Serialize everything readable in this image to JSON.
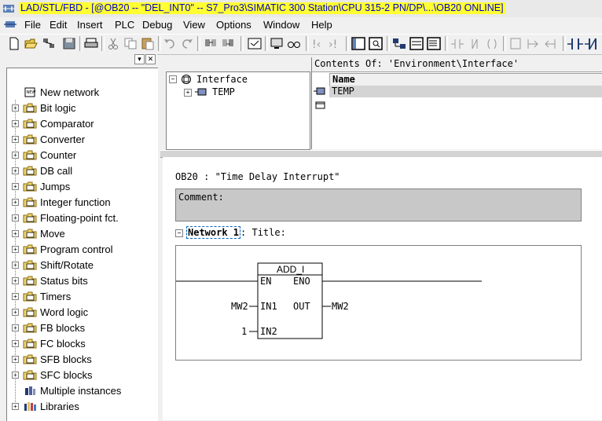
{
  "window": {
    "title": "LAD/STL/FBD  - [@OB20 -- \"DEL_INT0\" -- S7_Pro3\\SIMATIC 300 Station\\CPU 315-2 PN/DP\\...\\OB20  ONLINE]"
  },
  "menu": [
    "File",
    "Edit",
    "Insert",
    "PLC",
    "Debug",
    "View",
    "Options",
    "Window",
    "Help"
  ],
  "toolbar": {
    "icons": [
      "new-icon",
      "open-icon",
      "accessible-nodes-icon",
      "save-icon",
      "print-icon",
      "cut-icon",
      "copy-icon",
      "paste-icon",
      "undo-icon",
      "redo-icon",
      "download-icon",
      "upload-icon",
      "monitor-icon",
      "clear-icon",
      "rewire-icon",
      "overview-icon",
      "details-icon",
      "ref-icon",
      "stl-icon",
      "lad-icon",
      "contact-icon"
    ]
  },
  "pane_buttons": [
    "▾",
    "✕"
  ],
  "catalog": {
    "items": [
      {
        "label": "New network",
        "icon": "new-network-icon",
        "expandable": false
      },
      {
        "label": "Bit logic",
        "icon": "bit-logic-icon",
        "expandable": true
      },
      {
        "label": "Comparator",
        "icon": "comparator-icon",
        "expandable": true
      },
      {
        "label": "Converter",
        "icon": "converter-icon",
        "expandable": true
      },
      {
        "label": "Counter",
        "icon": "counter-icon",
        "expandable": true
      },
      {
        "label": "DB call",
        "icon": "db-call-icon",
        "expandable": true
      },
      {
        "label": "Jumps",
        "icon": "jumps-icon",
        "expandable": true
      },
      {
        "label": "Integer function",
        "icon": "integer-function-icon",
        "expandable": true
      },
      {
        "label": "Floating-point fct.",
        "icon": "floating-point-icon",
        "expandable": true
      },
      {
        "label": "Move",
        "icon": "move-icon",
        "expandable": true
      },
      {
        "label": "Program control",
        "icon": "program-control-icon",
        "expandable": true
      },
      {
        "label": "Shift/Rotate",
        "icon": "shift-rotate-icon",
        "expandable": true
      },
      {
        "label": "Status bits",
        "icon": "status-bits-icon",
        "expandable": true
      },
      {
        "label": "Timers",
        "icon": "timers-icon",
        "expandable": true
      },
      {
        "label": "Word logic",
        "icon": "word-logic-icon",
        "expandable": true
      },
      {
        "label": "FB blocks",
        "icon": "fb-blocks-icon",
        "expandable": true
      },
      {
        "label": "FC blocks",
        "icon": "fc-blocks-icon",
        "expandable": true
      },
      {
        "label": "SFB blocks",
        "icon": "sfb-blocks-icon",
        "expandable": true
      },
      {
        "label": "SFC blocks",
        "icon": "sfc-blocks-icon",
        "expandable": true
      },
      {
        "label": "Multiple instances",
        "icon": "multiple-instances-icon",
        "expandable": false
      },
      {
        "label": "Libraries",
        "icon": "libraries-icon",
        "expandable": true
      }
    ]
  },
  "interface": {
    "tree_root": "Interface",
    "tree_child": "TEMP",
    "contents_header": "Contents Of: 'Environment\\Interface'",
    "column_name": "Name",
    "rows": [
      "TEMP"
    ]
  },
  "code": {
    "block_title": "OB20 :  \"Time Delay Interrupt\"",
    "comment_label": "Comment:",
    "network_label": "Network 1",
    "network_title": ": Title:",
    "block": {
      "name": "ADD_I",
      "pin_en": "EN",
      "pin_eno": "ENO",
      "pin_in1": "IN1",
      "pin_in2": "IN2",
      "pin_out": "OUT",
      "in1_operand": "MW2",
      "in2_operand": "1",
      "out_operand": "MW2"
    }
  },
  "colors": {
    "title_highlight": "#ffff32",
    "title_text": "#0000cc",
    "comment_bg": "#c8c8c8"
  }
}
